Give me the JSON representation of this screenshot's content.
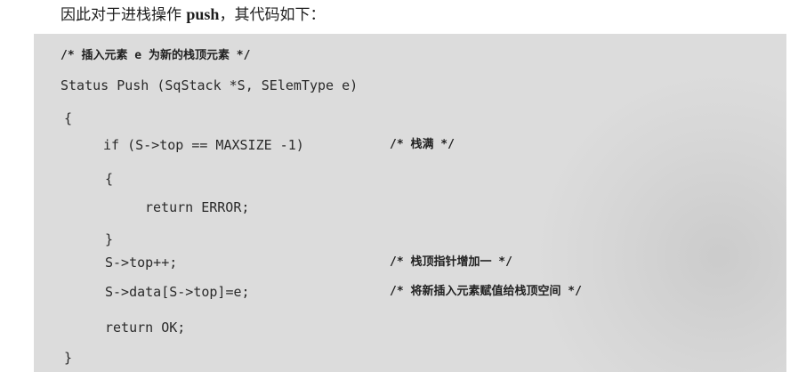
{
  "intro": {
    "prefix": "因此对于进栈操作",
    "keyword": "push",
    "suffix": "，其代码如下："
  },
  "code": {
    "header_comment": "/* 插入元素 e 为新的栈顶元素 */",
    "signature": "Status Push (SqStack *S, SElemType e)",
    "open_brace": "{",
    "if_stmt": "if (S->top == MAXSIZE -1)",
    "if_comment": "/* 栈满 */",
    "inner_open_brace": "{",
    "return_error": "return ERROR;",
    "inner_close_brace": "}",
    "top_increment": "S->top++;",
    "top_increment_comment": "/* 栈顶指针增加一 */",
    "data_assign": "S->data[S->top]=e;",
    "data_assign_comment": "/* 将新插入元素赋值给栈顶空间 */",
    "return_ok": "return OK;",
    "close_brace": "}"
  }
}
